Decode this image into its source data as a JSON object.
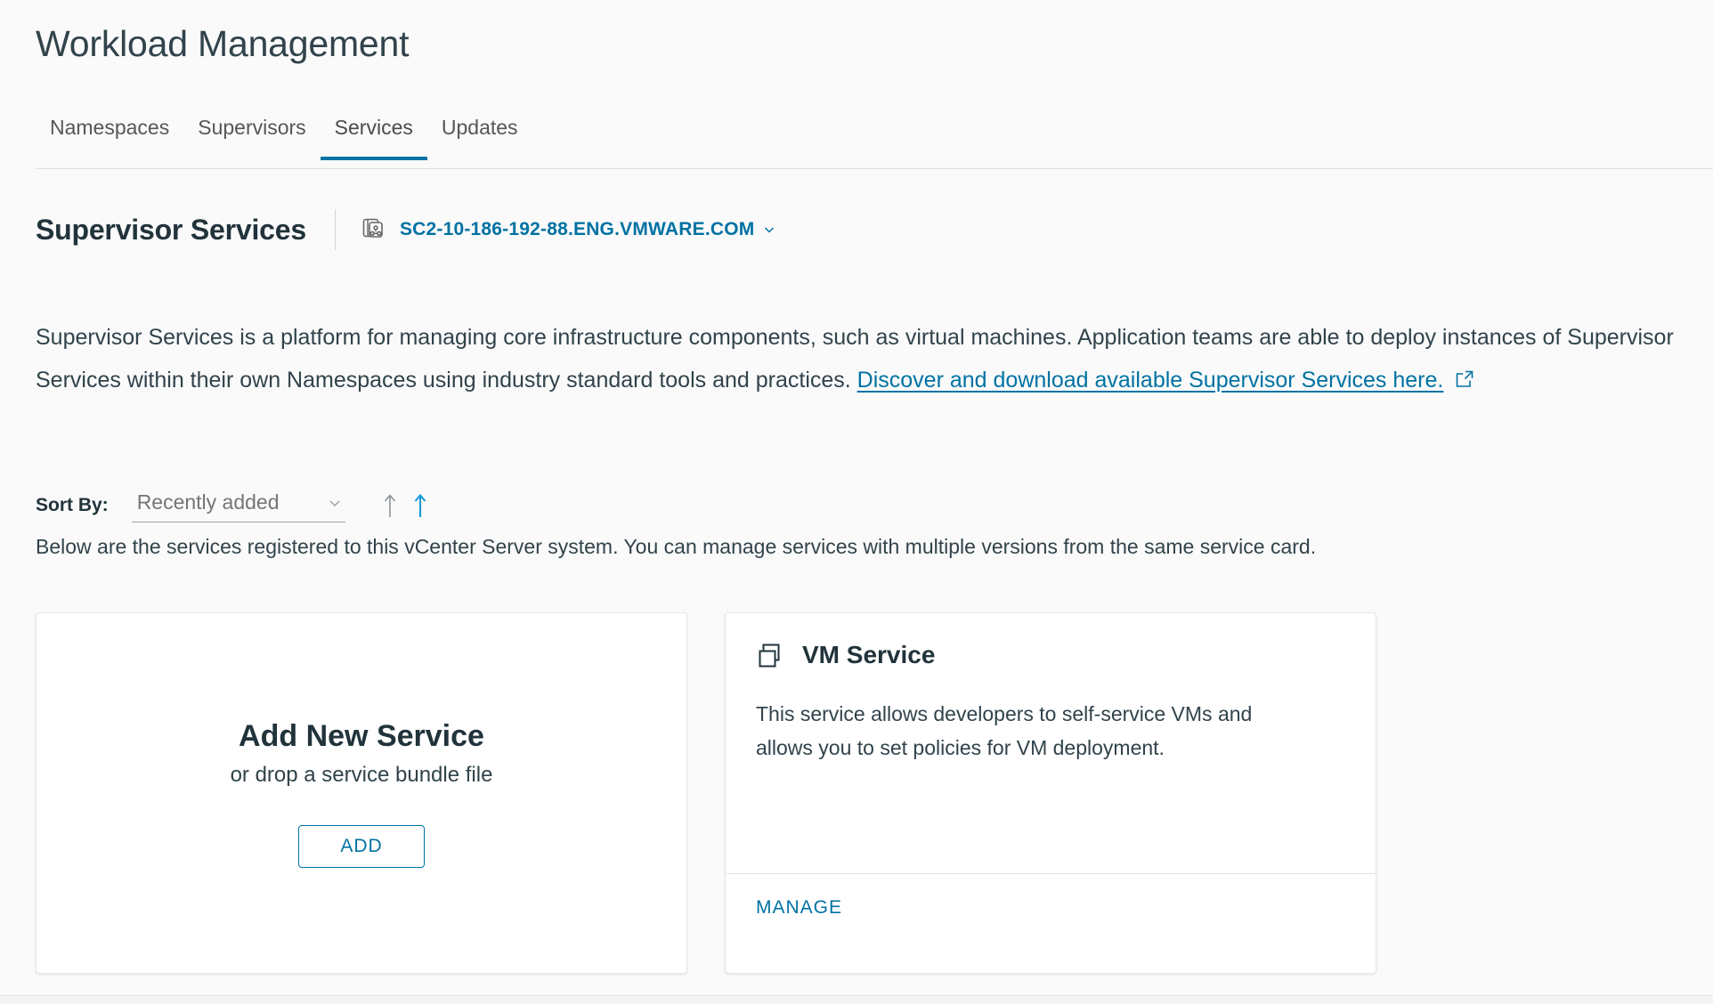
{
  "header": {
    "title": "Workload Management"
  },
  "tabs": [
    {
      "label": "Namespaces",
      "active": false,
      "name": "tab-namespaces"
    },
    {
      "label": "Supervisors",
      "active": false,
      "name": "tab-supervisors"
    },
    {
      "label": "Services",
      "active": true,
      "name": "tab-services"
    },
    {
      "label": "Updates",
      "active": false,
      "name": "tab-updates"
    }
  ],
  "section": {
    "title": "Supervisor Services",
    "server_name": "SC2-10-186-192-88.ENG.VMWARE.COM",
    "server_icon": "supervisor-cluster-icon",
    "chevron_icon": "chevron-down-icon"
  },
  "description": {
    "text_before_link": "Supervisor Services is a platform for managing core infrastructure components, such as virtual machines. Application teams are able to deploy instances of Supervisor Services within their own Namespaces using industry standard tools and practices. ",
    "link_text": "Discover and download available Supervisor Services here.",
    "link_icon": "external-link-icon"
  },
  "sort": {
    "label": "Sort By:",
    "selected": "Recently added",
    "options": [
      "Recently added"
    ],
    "chevron_icon": "chevron-down-icon",
    "ascending_icon": "arrow-up-icon",
    "descending_icon": "arrow-up-active-icon"
  },
  "subnote": "Below are the services registered to this vCenter Server system. You can manage services with multiple versions from the same service card.",
  "add_card": {
    "title": "Add New Service",
    "subtitle": "or drop a service bundle file",
    "button_label": "ADD"
  },
  "services": [
    {
      "name": "VM Service",
      "icon": "vm-service-icon",
      "description": "This service allows developers to self-service VMs and allows you to set policies for VM deployment.",
      "action_label": "MANAGE"
    }
  ],
  "colors": {
    "accent": "#0072a3",
    "text": "#21333b",
    "muted": "#757575",
    "page_bg": "#fafafa",
    "card_bg": "#ffffff",
    "border": "#e3e9eb"
  }
}
